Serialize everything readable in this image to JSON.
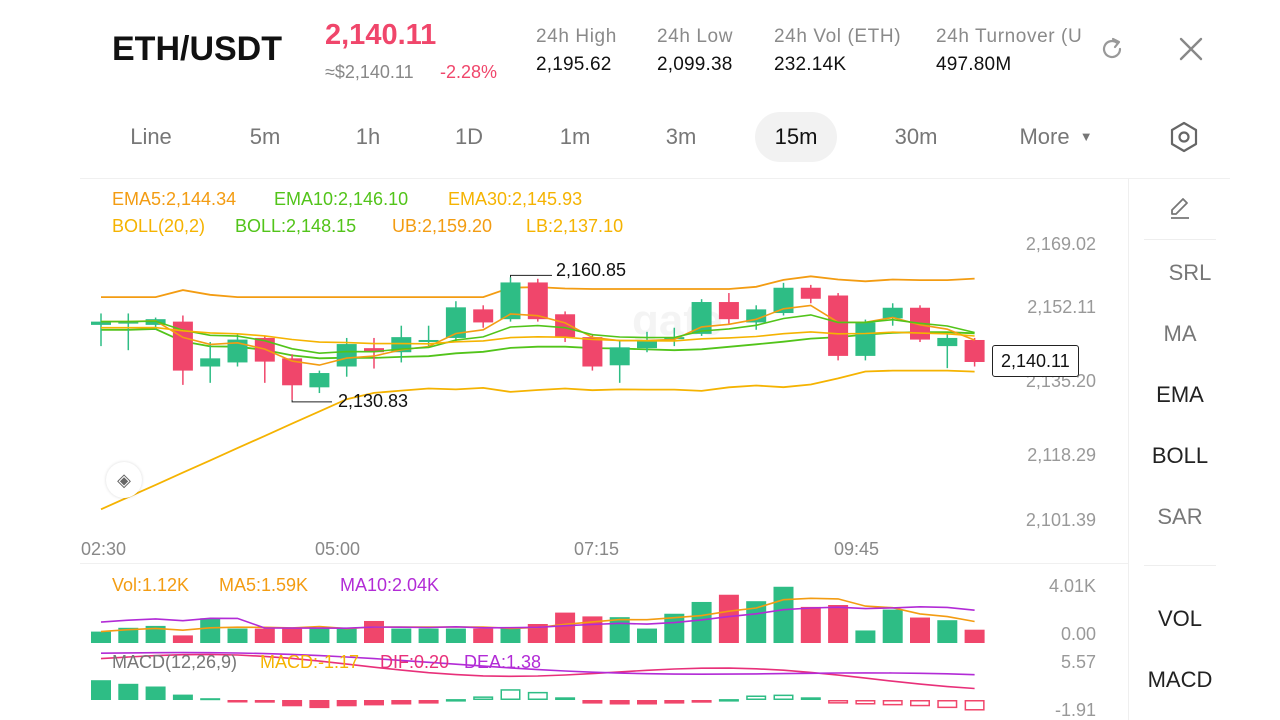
{
  "header": {
    "pair": "ETH/USDT",
    "price": "2,140.11",
    "fiat": "≈$2,140.11",
    "change": "-2.28%",
    "stats": [
      {
        "label": "24h  High",
        "value": "2,195.62"
      },
      {
        "label": "24h  Low",
        "value": "2,099.38"
      },
      {
        "label": "24h  Vol (ETH)",
        "value": "232.14K"
      },
      {
        "label": "24h  Turnover (U",
        "value": "497.80M"
      }
    ]
  },
  "timeframes": [
    "Line",
    "5m",
    "1h",
    "1D",
    "1m",
    "3m",
    "15m",
    "30m"
  ],
  "active_timeframe": "15m",
  "more_label": "More",
  "indicators": {
    "ema": {
      "ema5": "EMA5:2,144.34",
      "ema10": "EMA10:2,146.10",
      "ema30": "EMA30:2,145.93"
    },
    "boll": {
      "params": "BOLL(20,2)",
      "mid": "BOLL:2,148.15",
      "ub": "UB:2,159.20",
      "lb": "LB:2,137.10"
    },
    "vol": {
      "vol": "Vol:1.12K",
      "ma5": "MA5:1.59K",
      "ma10": "MA10:2.04K"
    },
    "macd": {
      "params": "MACD(12,26,9)",
      "macd": "MACD:-1.17",
      "dif": "DIF:0.20",
      "dea": "DEA:1.38"
    }
  },
  "sidebar": {
    "top": [
      "SRL",
      "MA",
      "EMA",
      "BOLL",
      "SAR"
    ],
    "bottom": [
      "VOL",
      "MACD"
    ]
  },
  "axes": {
    "price": [
      "2,169.02",
      "2,152.11",
      "2,135.20",
      "2,118.29",
      "2,101.39"
    ],
    "time": [
      "02:30",
      "05:00",
      "07:15",
      "09:45"
    ],
    "vol": [
      "4.01K",
      "0.00"
    ],
    "macd": [
      "5.57",
      "-1.91"
    ]
  },
  "annotations": {
    "high": "2,160.85",
    "low": "2,130.83",
    "last": "2,140.11"
  },
  "colors": {
    "up": "#2ebd85",
    "down": "#f0466b",
    "ema5": "#f39c12",
    "ema10": "#52c41a",
    "ema30": "#f5b301",
    "boll_mid": "#52c41a",
    "macd_purple": "#b22bd6",
    "macd_pink": "#e8307a"
  },
  "chart_data": {
    "type": "candlestick",
    "interval": "15m",
    "price_axis_ticks": [
      "2,169.02",
      "2,152.11",
      "2,135.20",
      "2,118.29",
      "2,101.39"
    ],
    "time_axis_ticks": [
      "02:30",
      "05:00",
      "07:15",
      "09:45"
    ],
    "candles": [
      {
        "o": 2149.2,
        "c": 2150.0,
        "h": 2152.0,
        "l": 2144.0
      },
      {
        "o": 2150.0,
        "c": 2150.0,
        "h": 2152.0,
        "l": 2143.0
      },
      {
        "o": 2149.2,
        "c": 2150.6,
        "h": 2151.0,
        "l": 2148.0
      },
      {
        "o": 2150.0,
        "c": 2138.0,
        "h": 2151.5,
        "l": 2134.5
      },
      {
        "o": 2139.0,
        "c": 2141.0,
        "h": 2145.0,
        "l": 2135.0
      },
      {
        "o": 2140.0,
        "c": 2145.6,
        "h": 2147.0,
        "l": 2139.0
      },
      {
        "o": 2146.0,
        "c": 2140.2,
        "h": 2146.5,
        "l": 2135.0
      },
      {
        "o": 2141.0,
        "c": 2134.4,
        "h": 2142.0,
        "l": 2130.83
      },
      {
        "o": 2133.9,
        "c": 2137.4,
        "h": 2138.0,
        "l": 2132.5
      },
      {
        "o": 2139.0,
        "c": 2144.5,
        "h": 2146.0,
        "l": 2136.5
      },
      {
        "o": 2143.5,
        "c": 2142.5,
        "h": 2146.0,
        "l": 2138.5
      },
      {
        "o": 2142.5,
        "c": 2146.2,
        "h": 2149.0,
        "l": 2140.0
      },
      {
        "o": 2145.5,
        "c": 2145.5,
        "h": 2149.0,
        "l": 2144.0
      },
      {
        "o": 2146.0,
        "c": 2153.5,
        "h": 2155.0,
        "l": 2145.0
      },
      {
        "o": 2153.0,
        "c": 2149.8,
        "h": 2154.0,
        "l": 2148.5
      },
      {
        "o": 2150.6,
        "c": 2159.6,
        "h": 2160.85,
        "l": 2150.0
      },
      {
        "o": 2159.6,
        "c": 2150.6,
        "h": 2160.5,
        "l": 2150.0
      },
      {
        "o": 2151.8,
        "c": 2146.2,
        "h": 2152.5,
        "l": 2145.0
      },
      {
        "o": 2146.2,
        "c": 2139.0,
        "h": 2147.0,
        "l": 2138.0
      },
      {
        "o": 2139.3,
        "c": 2143.7,
        "h": 2145.5,
        "l": 2135.0
      },
      {
        "o": 2143.5,
        "c": 2145.5,
        "h": 2147.5,
        "l": 2142.5
      },
      {
        "o": 2146.0,
        "c": 2146.2,
        "h": 2148.5,
        "l": 2144.0
      },
      {
        "o": 2147.0,
        "c": 2154.8,
        "h": 2155.5,
        "l": 2146.5
      },
      {
        "o": 2154.8,
        "c": 2150.6,
        "h": 2157.0,
        "l": 2149.5
      },
      {
        "o": 2149.8,
        "c": 2153.0,
        "h": 2154.0,
        "l": 2148.0
      },
      {
        "o": 2152.1,
        "c": 2158.3,
        "h": 2159.5,
        "l": 2151.5
      },
      {
        "o": 2158.3,
        "c": 2155.6,
        "h": 2159.0,
        "l": 2154.5
      },
      {
        "o": 2156.4,
        "c": 2141.6,
        "h": 2157.0,
        "l": 2140.5
      },
      {
        "o": 2141.6,
        "c": 2149.8,
        "h": 2150.5,
        "l": 2140.5
      },
      {
        "o": 2150.8,
        "c": 2153.4,
        "h": 2154.5,
        "l": 2149.0
      },
      {
        "o": 2153.4,
        "c": 2145.6,
        "h": 2154.0,
        "l": 2145.0
      },
      {
        "o": 2144.0,
        "c": 2146.0,
        "h": 2147.0,
        "l": 2138.6
      },
      {
        "o": 2145.5,
        "c": 2140.11,
        "h": 2146.0,
        "l": 2139.0
      }
    ],
    "volume": [
      0.3,
      0.4,
      0.45,
      0.2,
      0.65,
      0.38,
      0.38,
      0.38,
      0.38,
      0.38,
      0.58,
      0.38,
      0.38,
      0.38,
      0.38,
      0.4,
      0.5,
      0.8,
      0.7,
      0.68,
      0.38,
      0.77,
      1.08,
      1.27,
      1.1,
      1.48,
      0.95,
      1.0,
      0.33,
      0.88,
      0.67,
      0.6,
      0.35
    ],
    "macd_hist": [
      2.2,
      1.8,
      1.5,
      0.6,
      0.2,
      -0.1,
      -0.3,
      -0.7,
      -0.9,
      -0.7,
      -0.6,
      -0.5,
      -0.4,
      0.1,
      0.4,
      1.2,
      0.9,
      0.3,
      -0.4,
      -0.5,
      -0.5,
      -0.4,
      -0.3,
      0.1,
      0.5,
      0.6,
      0.3,
      -0.4,
      -0.5,
      -0.6,
      -0.7,
      -0.9,
      -1.17
    ]
  }
}
